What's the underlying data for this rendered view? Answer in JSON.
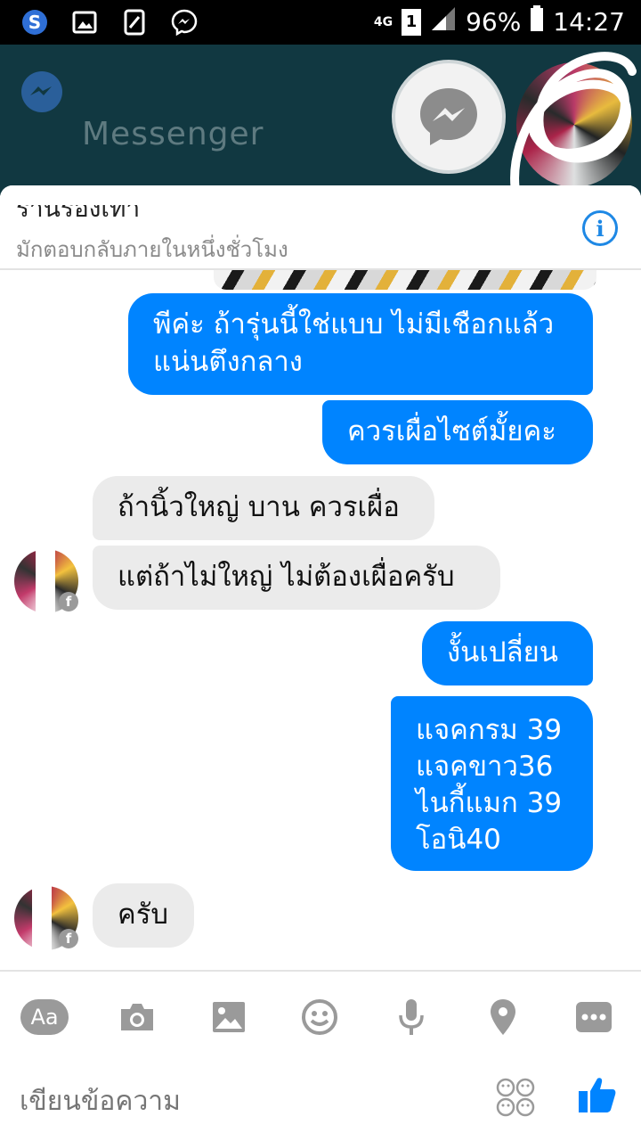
{
  "status_bar": {
    "network": "4G",
    "sim": "1",
    "battery": "96%",
    "time": "14:27"
  },
  "app_header": {
    "title": "Messenger"
  },
  "chat": {
    "subtitle": "มักตอบกลับภายในหนึ่งชั่วโมง",
    "contact_name_partial": "ร้านรองเท้า"
  },
  "messages": [
    {
      "from": "me",
      "text": "พีค่ะ ถ้ารุ่นนี้ใช่แบบ ไม่มีเชือกแล้ว\nแน่นตึงกลาง"
    },
    {
      "from": "me",
      "text": "ควรเผื่อไซต์มั้ยคะ"
    },
    {
      "from": "them",
      "text": "ถ้านิ้วใหญ่ บาน ควรเผื่อ"
    },
    {
      "from": "them",
      "text": "แต่ถ้าไม่ใหญ่ ไม่ต้องเผื่อครับ"
    },
    {
      "from": "me",
      "text": "งั้นเปลี่ยน"
    },
    {
      "from": "me",
      "text": "แจคกรม 39\nแจคขาว36\nไนกี้แมก 39\nโอนิ40"
    },
    {
      "from": "them",
      "text": "ครับ"
    }
  ],
  "composer": {
    "aa_label": "Aa",
    "placeholder": "เขียนข้อความ"
  },
  "colors": {
    "outgoing": "#0084ff",
    "incoming": "#ebebeb",
    "accent": "#1e88e5",
    "header_bg": "#113841"
  }
}
